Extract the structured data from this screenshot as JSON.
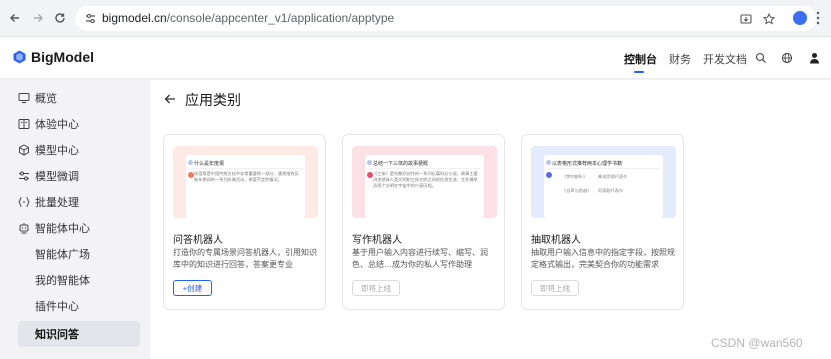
{
  "browser": {
    "url_host": "bigmodel.cn",
    "url_path": "/console/appcenter_v1/application/apptype"
  },
  "header": {
    "logo_text": "BigModel",
    "nav": [
      "控制台",
      "财务",
      "开发文档"
    ],
    "active_nav": "控制台",
    "accent_color": "#2563eb"
  },
  "sidebar": {
    "items": [
      {
        "label": "概览",
        "icon": "monitor-icon"
      },
      {
        "label": "体验中心",
        "icon": "book-icon"
      },
      {
        "label": "模型中心",
        "icon": "cube-icon"
      },
      {
        "label": "模型微调",
        "icon": "tune-icon"
      },
      {
        "label": "批量处理",
        "icon": "brackets-icon"
      },
      {
        "label": "智能体中心",
        "icon": "robot-icon"
      }
    ],
    "sub_items": [
      "智能体广场",
      "我的智能体",
      "插件中心",
      "知识问答"
    ],
    "selected": "知识问答"
  },
  "main": {
    "title": "应用类别",
    "cards": [
      {
        "title": "问答机器人",
        "desc": "打造你的专属场景问答机器人，引用知识库中的知识进行回答，答案更专业",
        "button": "+创建",
        "button_state": "primary",
        "preview": {
          "bg": "#fdeae4",
          "question": "什么是年度报",
          "answer": "年度报是中国传统文化中非常重要的一部分，通常指农历新年期间的一系列庆典活动，季度不定的情况。"
        }
      },
      {
        "title": "写作机器人",
        "desc": "基于用户输入内容进行续写、缩写、润色、总结…成为你的私人写作助理",
        "button": "即将上线",
        "button_state": "disabled",
        "preview": {
          "bg": "#fbe1e6",
          "question": "总结一下三体的故事梗概",
          "answer": "《三体》是刘慈欣创作的一系列长篇科幻小说，故事主要讲述地球人类文明和三体文明之间的信息交流、生死搏杀及两个文明在宇宙中的兴衰历程。"
        }
      },
      {
        "title": "抽取机器人",
        "desc": "抽取用户输入信息中的指定字段，按照规定格式输出，完美契合你的功能需求",
        "button": "即将上线",
        "button_state": "disabled",
        "preview": {
          "bg": "#e3ebfc",
          "question": "以表格形式推荐两本心理学书籍",
          "rows": [
            [
              "《梦的解析》",
              "弗洛伊德代表作"
            ],
            [
              "《自卑与超越》",
              "阿德勒代表作"
            ]
          ]
        }
      }
    ]
  },
  "watermark": "CSDN @wan560"
}
